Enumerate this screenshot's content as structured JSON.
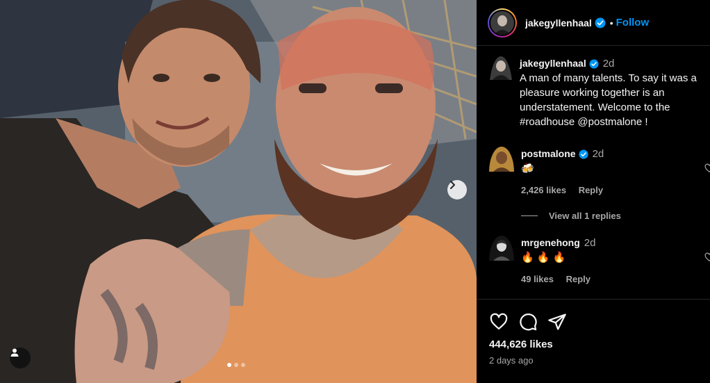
{
  "post": {
    "author": "jakegyllenhaal",
    "follow_label": "Follow",
    "separator": "•",
    "caption": {
      "username": "jakegyllenhaal",
      "time": "2d",
      "text": "A man of many talents. To say it was a pleasure working together is an understatement. Welcome to the #roadhouse @postmalone !"
    },
    "comments": [
      {
        "username": "postmalone",
        "verified": true,
        "time": "2d",
        "text": "🍻",
        "likes": "2,426 likes",
        "reply_label": "Reply",
        "view_replies": "View all 1 replies"
      },
      {
        "username": "mrgenehong",
        "verified": false,
        "time": "2d",
        "text": "🔥 🔥 🔥",
        "likes": "49 likes",
        "reply_label": "Reply"
      }
    ],
    "likes_total": "444,626 likes",
    "posted": "2 days ago",
    "carousel": {
      "current": 1,
      "total": 3
    }
  },
  "colors": {
    "accent": "#0095f6",
    "background": "#000000",
    "muted": "#a8a8a8"
  },
  "icons": [
    "verified-icon",
    "heart-icon",
    "comment-icon",
    "share-icon",
    "chevron-right-icon",
    "user-tag-icon"
  ]
}
